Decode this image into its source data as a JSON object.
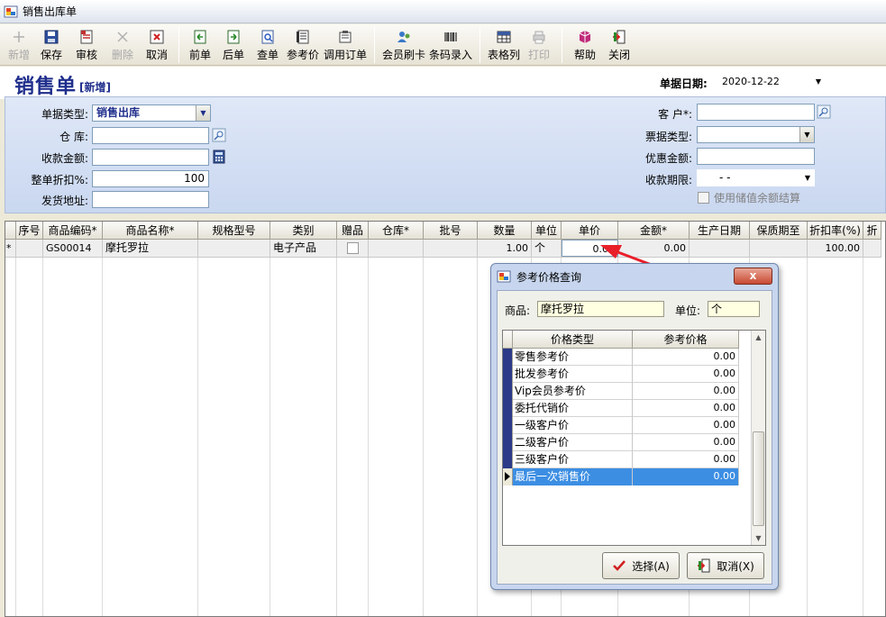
{
  "window": {
    "title": "销售出库单"
  },
  "toolbar": {
    "buttons": [
      {
        "label": "新增",
        "icon": "new-icon",
        "disabled": true
      },
      {
        "label": "保存",
        "icon": "save-icon"
      },
      {
        "label": "审核",
        "icon": "audit-icon"
      },
      {
        "label": "删除",
        "icon": "delete-icon",
        "disabled": true
      },
      {
        "label": "取消",
        "icon": "cancel-icon"
      },
      {
        "label": "前单",
        "icon": "prev-doc-icon"
      },
      {
        "label": "后单",
        "icon": "next-doc-icon"
      },
      {
        "label": "查单",
        "icon": "find-doc-icon"
      },
      {
        "label": "参考价",
        "icon": "ref-price-icon"
      },
      {
        "label": "调用订单",
        "icon": "call-order-icon"
      },
      {
        "label": "会员刷卡",
        "icon": "member-card-icon"
      },
      {
        "label": "条码录入",
        "icon": "barcode-icon"
      },
      {
        "label": "表格列",
        "icon": "grid-columns-icon"
      },
      {
        "label": "打印",
        "icon": "print-icon",
        "disabled": true
      },
      {
        "label": "帮助",
        "icon": "help-icon"
      },
      {
        "label": "关闭",
        "icon": "close-door-icon"
      }
    ]
  },
  "document": {
    "title": "销售单",
    "status": "[新增]",
    "date_label": "单据日期:",
    "date_value": "2020-12-22"
  },
  "form": {
    "doc_type_label": "单据类型:",
    "doc_type_value": "销售出库",
    "warehouse_label": "仓    库:",
    "warehouse_value": "",
    "receipt_amount_label": "收款金额:",
    "receipt_amount_value": "",
    "discount_label": "整单折扣%:",
    "discount_value": "100",
    "ship_address_label": "发货地址:",
    "ship_address_value": "",
    "customer_label": "客    户*:",
    "customer_value": "",
    "invoice_type_label": "票据类型:",
    "invoice_type_value": "",
    "preferential_label": "优惠金额:",
    "preferential_value": "",
    "payment_term_label": "收款期限:",
    "payment_term_value": "-  -",
    "use_balance_label": "使用储值余额结算"
  },
  "grid": {
    "headers": [
      "",
      "序号",
      "商品编码*",
      "商品名称*",
      "规格型号",
      "类别",
      "赠品",
      "仓库*",
      "批号",
      "数量",
      "单位",
      "单价",
      "金额*",
      "生产日期",
      "保质期至",
      "折扣率(%)",
      "折"
    ],
    "rows": [
      {
        "indicator": "*",
        "seq": "",
        "code": "GS00014",
        "name": "摩托罗拉",
        "spec": "",
        "category": "电子产品",
        "gift": "",
        "warehouse": "",
        "batch": "",
        "qty": "1.00",
        "unit": "个",
        "price": "0.00",
        "amount": "0.00",
        "prod_date": "",
        "expire": "",
        "discount": "100.00",
        "extra": ""
      }
    ]
  },
  "dialog": {
    "title": "参考价格查询",
    "close_label": "x",
    "product_label": "商品:",
    "product_value": "摩托罗拉",
    "unit_label": "单位:",
    "unit_value": "个",
    "headers": [
      "价格类型",
      "参考价格"
    ],
    "rows": [
      {
        "name": "零售参考价",
        "price": "0.00"
      },
      {
        "name": "批发参考价",
        "price": "0.00"
      },
      {
        "name": "Vip会员参考价",
        "price": "0.00"
      },
      {
        "name": "委托代销价",
        "price": "0.00"
      },
      {
        "name": "一级客户价",
        "price": "0.00"
      },
      {
        "name": "二级客户价",
        "price": "0.00"
      },
      {
        "name": "三级客户价",
        "price": "0.00"
      },
      {
        "name": "最后一次销售价",
        "price": "0.00",
        "selected": true
      }
    ],
    "select_label": "选择(A)",
    "cancel_label": "取消(X)"
  },
  "colors": {
    "accent": "#1f2e8c",
    "selection": "#3c8ee3",
    "annotation_arrow": "#e8202a"
  }
}
